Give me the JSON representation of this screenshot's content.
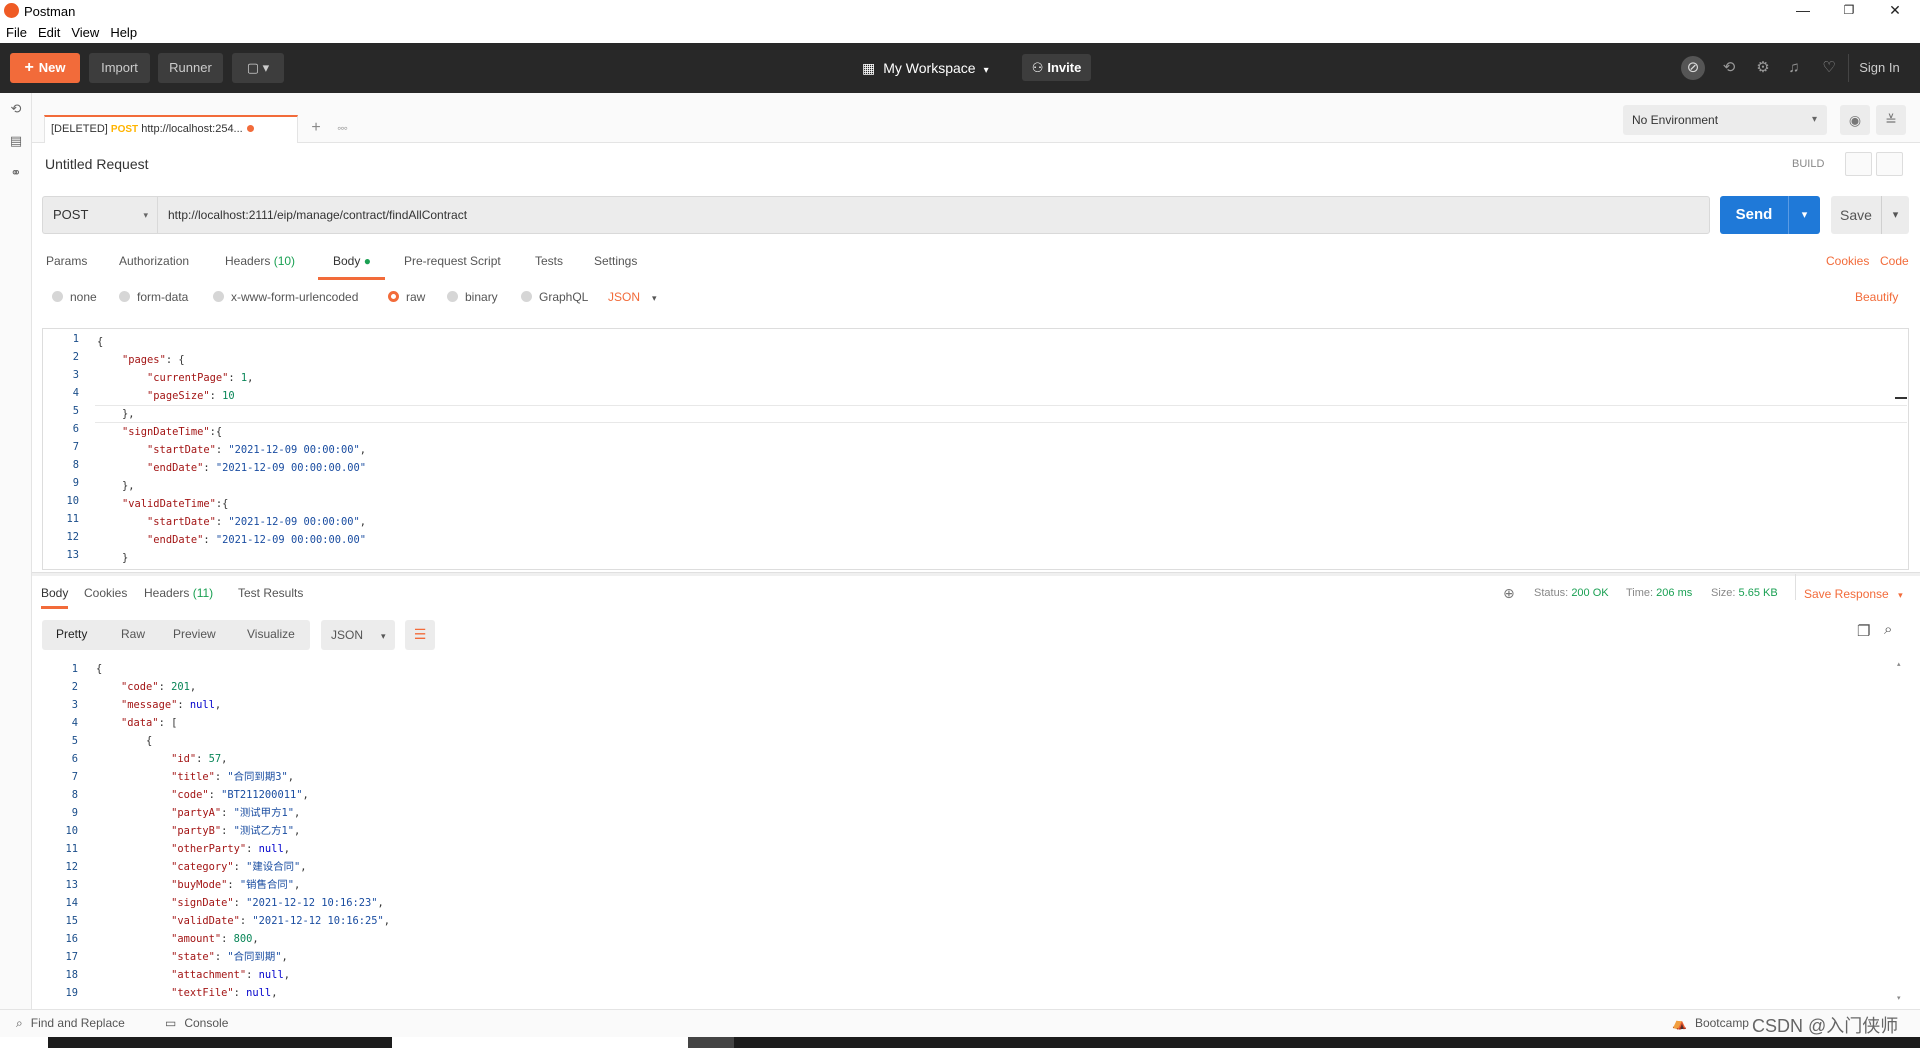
{
  "window": {
    "title": "Postman",
    "minimize": "—",
    "maximize": "❐",
    "close": "✕"
  },
  "menu": [
    "File",
    "Edit",
    "View",
    "Help"
  ],
  "header": {
    "new_label": "New",
    "import_label": "Import",
    "runner_label": "Runner",
    "workspace_label": "My Workspace",
    "invite_label": "Invite",
    "signin_label": "Sign In"
  },
  "tab": {
    "prefix": "[DELETED]",
    "method": "POST",
    "url": "http://localhost:254..."
  },
  "environment": {
    "selected": "No Environment"
  },
  "request": {
    "name": "Untitled Request",
    "build_label": "BUILD",
    "method": "POST",
    "url": "http://localhost:2111/eip/manage/contract/findAllContract",
    "send_label": "Send",
    "save_label": "Save"
  },
  "request_tabs": [
    {
      "label": "Params"
    },
    {
      "label": "Authorization"
    },
    {
      "label": "Headers",
      "count": "(10)"
    },
    {
      "label": "Body"
    },
    {
      "label": "Pre-request Script"
    },
    {
      "label": "Tests"
    },
    {
      "label": "Settings"
    }
  ],
  "request_links": {
    "cookies": "Cookies",
    "code": "Code",
    "beautify": "Beautify"
  },
  "body_types": [
    "none",
    "form-data",
    "x-www-form-urlencoded",
    "raw",
    "binary",
    "GraphQL"
  ],
  "body_format": "JSON",
  "request_body_lines": [
    "1",
    "2",
    "3",
    "4",
    "5",
    "6",
    "7",
    "8",
    "9",
    "10",
    "11",
    "12",
    "13"
  ],
  "response_tabs": [
    {
      "label": "Body"
    },
    {
      "label": "Cookies"
    },
    {
      "label": "Headers",
      "count": "(11)"
    },
    {
      "label": "Test Results"
    }
  ],
  "response_status": {
    "status_label": "Status:",
    "status": "200 OK",
    "time_label": "Time:",
    "time": "206 ms",
    "size_label": "Size:",
    "size": "5.65 KB",
    "save_label": "Save Response"
  },
  "response_views": [
    "Pretty",
    "Raw",
    "Preview",
    "Visualize"
  ],
  "response_format": "JSON",
  "footer": {
    "find_replace": "Find and Replace",
    "console": "Console",
    "bootcamp": "Bootcamp",
    "watermark": "CSDN @入门侠师"
  }
}
